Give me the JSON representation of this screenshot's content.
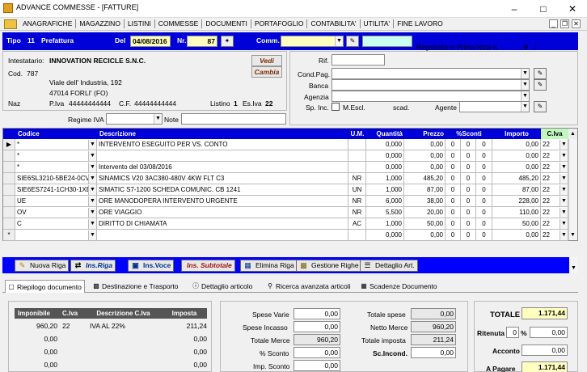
{
  "window": {
    "title": "ADVANCE COMMESSE - [FATTURE]"
  },
  "menu": [
    "ANAGRAFICHE",
    "MAGAZZINO",
    "LISTINI",
    "COMMESSE",
    "DOCUMENTI",
    "PORTAFOGLIO",
    "CONTABILITA'",
    "UTILITA'",
    "FINE LAVORO"
  ],
  "header": {
    "tipo_label": "Tipo",
    "tipo_num": "11",
    "tipo_name": "Prefattura",
    "del_label": "Del",
    "date": "04/08/2016",
    "nr_label": "Nr.",
    "nr": "87",
    "comm_label": "Comm.",
    "comm_value": "",
    "registered": "Registrato in  Prima Nota n.",
    "prima_nota_num": "0",
    "slash": "/"
  },
  "customer": {
    "intestatario_label": "Intestatario:",
    "name": "INNOVATION RECICLE S.N.C.",
    "cod_label": "Cod.",
    "cod": "787",
    "address": "Viale dell' Industria, 192",
    "city": "47014 FORLI' (FO)",
    "naz_label": "Naz",
    "piva_label": "P.Iva",
    "piva": "44444444444",
    "cf_label": "C.F.",
    "cf": "44444444444",
    "listino_label": "Listino",
    "listino": "1",
    "esiva_label": "Es.Iva",
    "esiva": "22",
    "vedi": "Vedi",
    "cambia": "Cambia",
    "regime_label": "Regime IVA",
    "note_label": "Note"
  },
  "right_panel": {
    "rif_label": "Rif.",
    "condpag_label": "Cond.Pag.",
    "banca_label": "Banca",
    "agenzia_label": "Agenzia",
    "spinc_label": "Sp. Inc.",
    "mescl_label": "M.Escl.",
    "scad_label": "scad.",
    "agente_label": "Agente"
  },
  "grid": {
    "headers": [
      "Codice",
      "Descrizione",
      "U.M.",
      "Quantità",
      "Prezzo",
      "%Sconti",
      "Importo",
      "C.Iva"
    ],
    "rows": [
      [
        "*",
        "INTERVENTO ESEGUITO PER VS. CONTO",
        "",
        "0,000",
        "0,00",
        "0",
        "0",
        "0",
        "0,00",
        "22"
      ],
      [
        "*",
        "",
        "",
        "0,000",
        "0,00",
        "0",
        "0",
        "0",
        "0,00",
        "22"
      ],
      [
        "*",
        "Intervento del 03/08/2016",
        "",
        "0,000",
        "0,00",
        "0",
        "0",
        "0",
        "0,00",
        "22"
      ],
      [
        "SIE6SL3210-5BE24-0CV0",
        "SINAMICS V20 3AC380-480V 4KW FLT C3",
        "NR",
        "1,000",
        "485,20",
        "0",
        "0",
        "0",
        "485,20",
        "22"
      ],
      [
        "SIE6ES7241-1CH30-1XB",
        "SIMATIC S7-1200 SCHEDA COMUNIC. CB 1241",
        "UN",
        "1,000",
        "87,00",
        "0",
        "0",
        "0",
        "87,00",
        "22"
      ],
      [
        "UE",
        "ORE MANODOPERA INTERVENTO URGENTE",
        "NR",
        "6,000",
        "38,00",
        "0",
        "0",
        "0",
        "228,00",
        "22"
      ],
      [
        "OV",
        "ORE VIAGGIO",
        "NR",
        "5,500",
        "20,00",
        "0",
        "0",
        "0",
        "110,00",
        "22"
      ],
      [
        "C",
        "DIRITTO DI CHIAMATA",
        "AC",
        "1,000",
        "50,00",
        "0",
        "0",
        "0",
        "50,00",
        "22"
      ],
      [
        "",
        "",
        "",
        "0,000",
        "0,00",
        "0",
        "0",
        "0",
        "0,00",
        "22"
      ]
    ]
  },
  "toolbar": [
    "Nuova Riga",
    "Ins.Riga",
    "Ins.Voce",
    "Ins. Subtotale",
    "Elimina Riga",
    "Gestione Righe",
    "Dettaglio Art."
  ],
  "tabs": [
    "Riepilogo documento",
    "Destinazione e Trasporto",
    "Dettaglio articolo",
    "Ricerca avanzata articoli",
    "Scadenze Documento"
  ],
  "summary": {
    "headers": [
      "Imponibile",
      "C.Iva",
      "Descrizione C.Iva",
      "Imposta"
    ],
    "rows": [
      [
        "960,20",
        "22",
        "IVA AL 22%",
        "211,24"
      ],
      [
        "0,00",
        "",
        "",
        "0,00"
      ],
      [
        "0,00",
        "",
        "",
        "0,00"
      ],
      [
        "0,00",
        "",
        "",
        "0,00"
      ]
    ],
    "spese_varie_label": "Spese Varie",
    "spese_varie": "0,00",
    "spese_incasso_label": "Spese Incasso",
    "spese_incasso": "0,00",
    "totale_merce_label": "Totale Merce",
    "totale_merce": "960,20",
    "sconto_label": "% Sconto",
    "sconto": "0,00",
    "imp_sconto_label": "Imp. Sconto",
    "imp_sconto": "0,00",
    "totale_spese_label": "Totale spese",
    "totale_spese": "0,00",
    "netto_merce_label": "Netto Merce",
    "netto_merce": "960,20",
    "totale_imposta_label": "Totale imposta",
    "totale_imposta": "211,24",
    "sc_incond_label": "Sc.Incond.",
    "sc_incond": "0,00",
    "totale_label": "TOTALE",
    "totale": "1.171,44",
    "ritenuta_label": "Ritenuta",
    "ritenuta_pct": "0",
    "ritenuta_pct_sign": "%",
    "ritenuta": "0,00",
    "acconto_label": "Acconto",
    "acconto": "0,00",
    "apagare_label": "A Pagare",
    "apagare": "1.171,44"
  },
  "colors": {
    "header_blue": "#0000d8",
    "toolbar_blue": "#0000ff",
    "highlight_yellow": "#ffffc0",
    "button_text": "#7a2a00"
  }
}
